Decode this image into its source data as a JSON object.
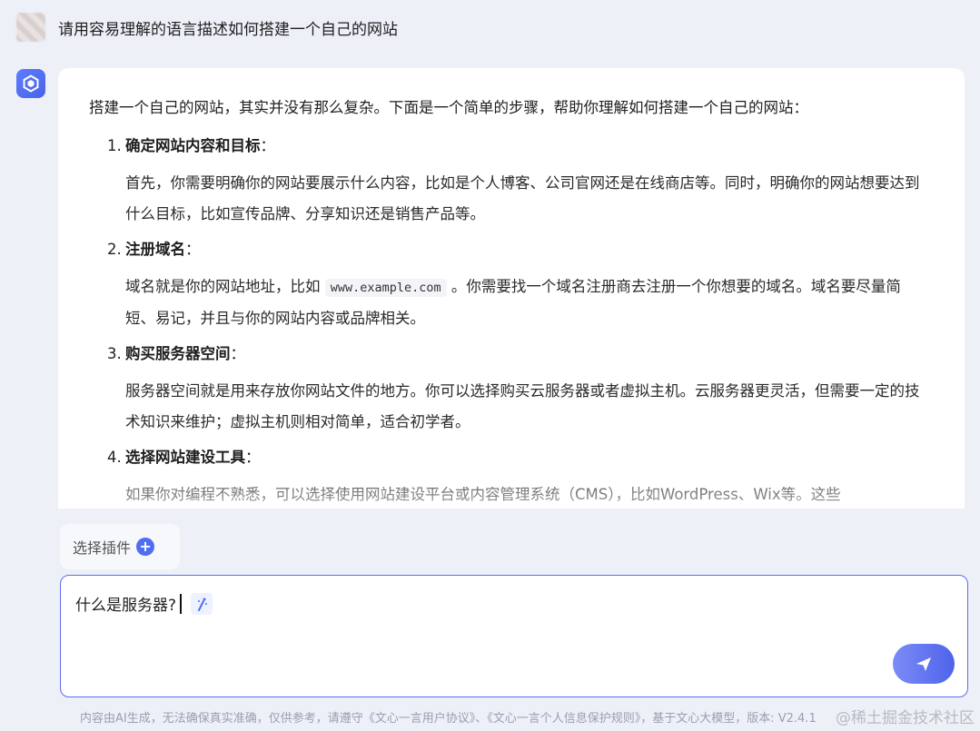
{
  "user": {
    "question": "请用容易理解的语言描述如何搭建一个自己的网站"
  },
  "answer": {
    "intro": "搭建一个自己的网站，其实并没有那么复杂。下面是一个简单的步骤，帮助你理解如何搭建一个自己的网站：",
    "steps": [
      {
        "num": "1.",
        "title": "确定网站内容和目标",
        "colon": "：",
        "body": "首先，你需要明确你的网站要展示什么内容，比如是个人博客、公司官网还是在线商店等。同时，明确你的网站想要达到什么目标，比如宣传品牌、分享知识还是销售产品等。"
      },
      {
        "num": "2.",
        "title": "注册域名",
        "colon": "：",
        "body_before": "域名就是你的网站地址，比如",
        "code": "www.example.com",
        "body_after": "。你需要找一个域名注册商去注册一个你想要的域名。域名要尽量简短、易记，并且与你的网站内容或品牌相关。"
      },
      {
        "num": "3.",
        "title": "购买服务器空间",
        "colon": "：",
        "body": "服务器空间就是用来存放你网站文件的地方。你可以选择购买云服务器或者虚拟主机。云服务器更灵活，但需要一定的技术知识来维护；虚拟主机则相对简单，适合初学者。"
      },
      {
        "num": "4.",
        "title": "选择网站建设工具",
        "colon": "：",
        "body": "如果你对编程不熟悉，可以选择使用网站建设平台或内容管理系统（CMS），比如WordPress、Wix等。这些"
      }
    ]
  },
  "plugin": {
    "label": "选择插件"
  },
  "input": {
    "value": "什么是服务器?"
  },
  "footer": {
    "disclaimer": "内容由AI生成，无法确保真实准确，仅供参考，请遵守《文心一言用户协议》、《文心一言个人信息保护规则》，基于文心大模型，版本: V2.4.1"
  },
  "watermark": "@稀土掘金技术社区",
  "colors": {
    "accent": "#4e6ef2",
    "background": "#eef0f8"
  }
}
